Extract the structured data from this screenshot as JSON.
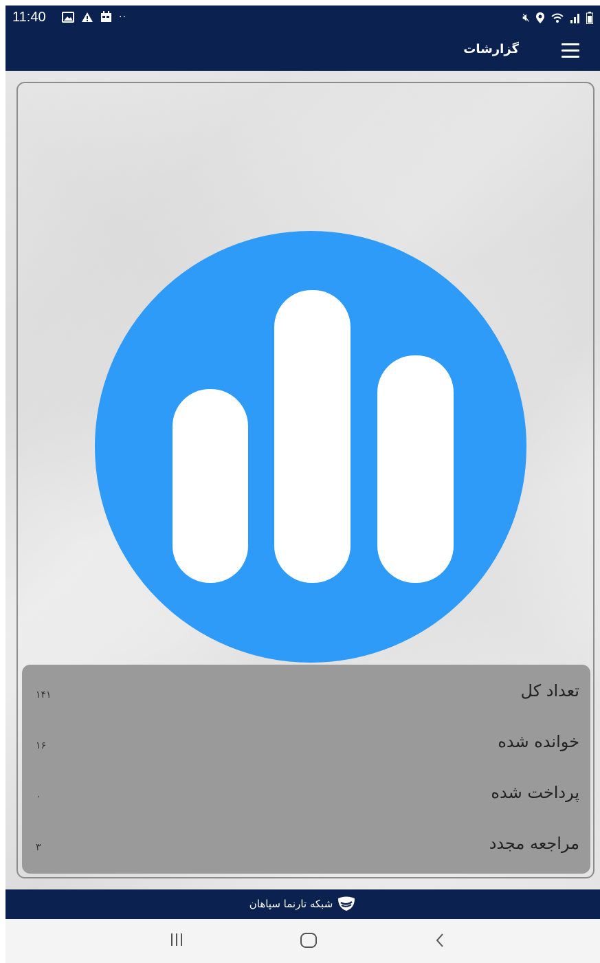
{
  "status_bar": {
    "time": "11:40",
    "left_icons": [
      "image-icon",
      "warning-icon",
      "calendar-icon",
      "more-dots-icon"
    ],
    "right_icons": [
      "mute-icon",
      "location-icon",
      "wifi-icon",
      "signal-icon",
      "battery-icon"
    ]
  },
  "app_bar": {
    "title": "گزارشات",
    "menu_icon": "hamburger-menu-icon",
    "background": "#0b2150"
  },
  "hero_icon": {
    "name": "bar-chart-icon",
    "color": "#2d9bf7"
  },
  "stats": [
    {
      "label": "تعداد کل",
      "value": "۱۴۱"
    },
    {
      "label": "خوانده شده",
      "value": "۱۶"
    },
    {
      "label": "پرداخت شده",
      "value": "۰"
    },
    {
      "label": "مراجعه مجدد",
      "value": "۳"
    }
  ],
  "footer": {
    "brand": "شبکه تارنما سپاهان",
    "logo_icon": "handshake-logo-icon"
  },
  "nav_bar": {
    "buttons": [
      "recent-apps-icon",
      "home-icon",
      "back-icon"
    ]
  }
}
